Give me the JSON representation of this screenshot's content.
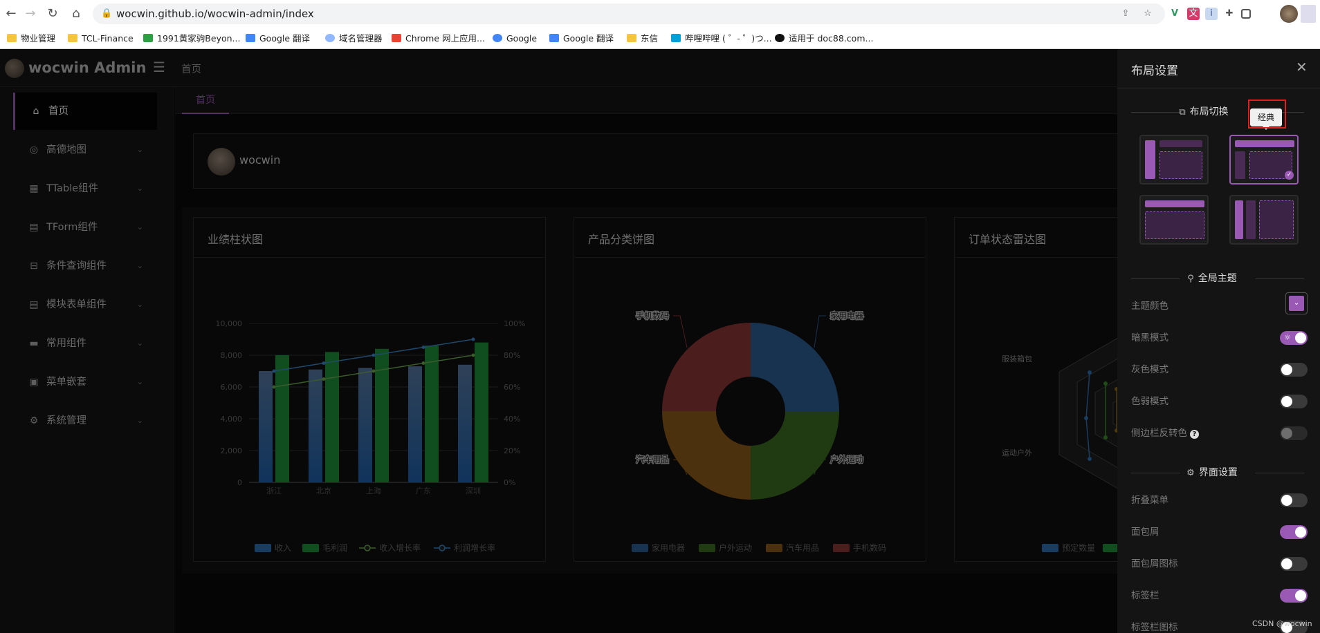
{
  "browser": {
    "url": "wocwin.github.io/wocwin-admin/index",
    "bookmarks": [
      "物业管理",
      "TCL-Finance",
      "1991黄家驹Beyon...",
      "Google 翻译",
      "域名管理器",
      "Chrome 网上应用...",
      "Google",
      "Google 翻译",
      "东信",
      "哔哩哔哩 ( ゜- ゜)つ...",
      "适用于 doc88.com..."
    ]
  },
  "header": {
    "title": "wocwin Admin",
    "breadcrumb": "首页"
  },
  "sidebar": {
    "items": [
      {
        "label": "首页",
        "icon": "home-icon"
      },
      {
        "label": "高德地图",
        "icon": "map-pin-icon"
      },
      {
        "label": "TTable组件",
        "icon": "grid-icon"
      },
      {
        "label": "TForm组件",
        "icon": "form-icon"
      },
      {
        "label": "条件查询组件",
        "icon": "search-form-icon"
      },
      {
        "label": "模块表单组件",
        "icon": "module-form-icon"
      },
      {
        "label": "常用组件",
        "icon": "briefcase-icon"
      },
      {
        "label": "菜单嵌套",
        "icon": "nested-menu-icon"
      },
      {
        "label": "系统管理",
        "icon": "gear-icon"
      }
    ]
  },
  "tabs": {
    "home": "首页"
  },
  "user": {
    "name": "wocwin"
  },
  "cards": {
    "bar_title": "业绩柱状图",
    "pie_title": "产品分类饼图",
    "radar_title": "订单状态雷达图"
  },
  "chart_data": [
    {
      "type": "bar",
      "title": "业绩柱状图",
      "categories": [
        "浙江",
        "北京",
        "上海",
        "广东",
        "深圳"
      ],
      "series": [
        {
          "name": "收入",
          "type": "bar",
          "axis": "left",
          "values": [
            7000,
            7100,
            7200,
            7300,
            7400
          ],
          "color": "#2f6fb0"
        },
        {
          "name": "毛利润",
          "type": "bar",
          "axis": "left",
          "values": [
            8000,
            8200,
            8400,
            8600,
            8800
          ],
          "color": "#1f8f3a"
        },
        {
          "name": "收入增长率",
          "type": "line",
          "axis": "right",
          "values": [
            60,
            65,
            70,
            75,
            80
          ],
          "color": "#6aa84f"
        },
        {
          "name": "利润增长率",
          "type": "line",
          "axis": "right",
          "values": [
            70,
            75,
            80,
            85,
            90
          ],
          "color": "#3d85c6"
        }
      ],
      "ylim": [
        0,
        10000
      ],
      "yticks": [
        "0",
        "2,000",
        "4,000",
        "6,000",
        "8,000",
        "10,000"
      ],
      "y2lim": [
        0,
        100
      ],
      "y2ticks": [
        "0%",
        "20%",
        "40%",
        "60%",
        "80%",
        "100%"
      ],
      "grid": true,
      "legend": "bottom"
    },
    {
      "type": "pie",
      "title": "产品分类饼图",
      "slices": [
        {
          "name": "家用电器",
          "value": 25,
          "color": "#2a5d93"
        },
        {
          "name": "户外运动",
          "value": 25,
          "color": "#3b6b22"
        },
        {
          "name": "汽车用品",
          "value": 25,
          "color": "#8a5a1c"
        },
        {
          "name": "手机数码",
          "value": 25,
          "color": "#8b3535"
        }
      ],
      "donut": true,
      "legend": "bottom"
    },
    {
      "type": "radar",
      "title": "订单状态雷达图",
      "indicators_visible": [
        "服装箱包",
        "运动户外"
      ],
      "legend_visible": [
        "预定数量"
      ],
      "legend": "bottom"
    }
  ],
  "drawer": {
    "title": "布局设置",
    "layout_section": "布局切换",
    "tooltip": "经典",
    "theme_section": "全局主题",
    "ui_section": "界面设置",
    "theme_color": "#9b59b6",
    "theme_settings": [
      {
        "label": "主题颜色",
        "control": "color"
      },
      {
        "label": "暗黑模式",
        "on": true
      },
      {
        "label": "灰色模式",
        "on": false
      },
      {
        "label": "色弱模式",
        "on": false
      },
      {
        "label": "侧边栏反转色",
        "on": false,
        "help": true
      }
    ],
    "ui_settings": [
      {
        "label": "折叠菜单",
        "on": false
      },
      {
        "label": "面包屑",
        "on": true
      },
      {
        "label": "面包屑图标",
        "on": false
      },
      {
        "label": "标签栏",
        "on": true
      },
      {
        "label": "标签栏图标",
        "on": false
      }
    ]
  },
  "watermark": "CSDN @wocwin"
}
